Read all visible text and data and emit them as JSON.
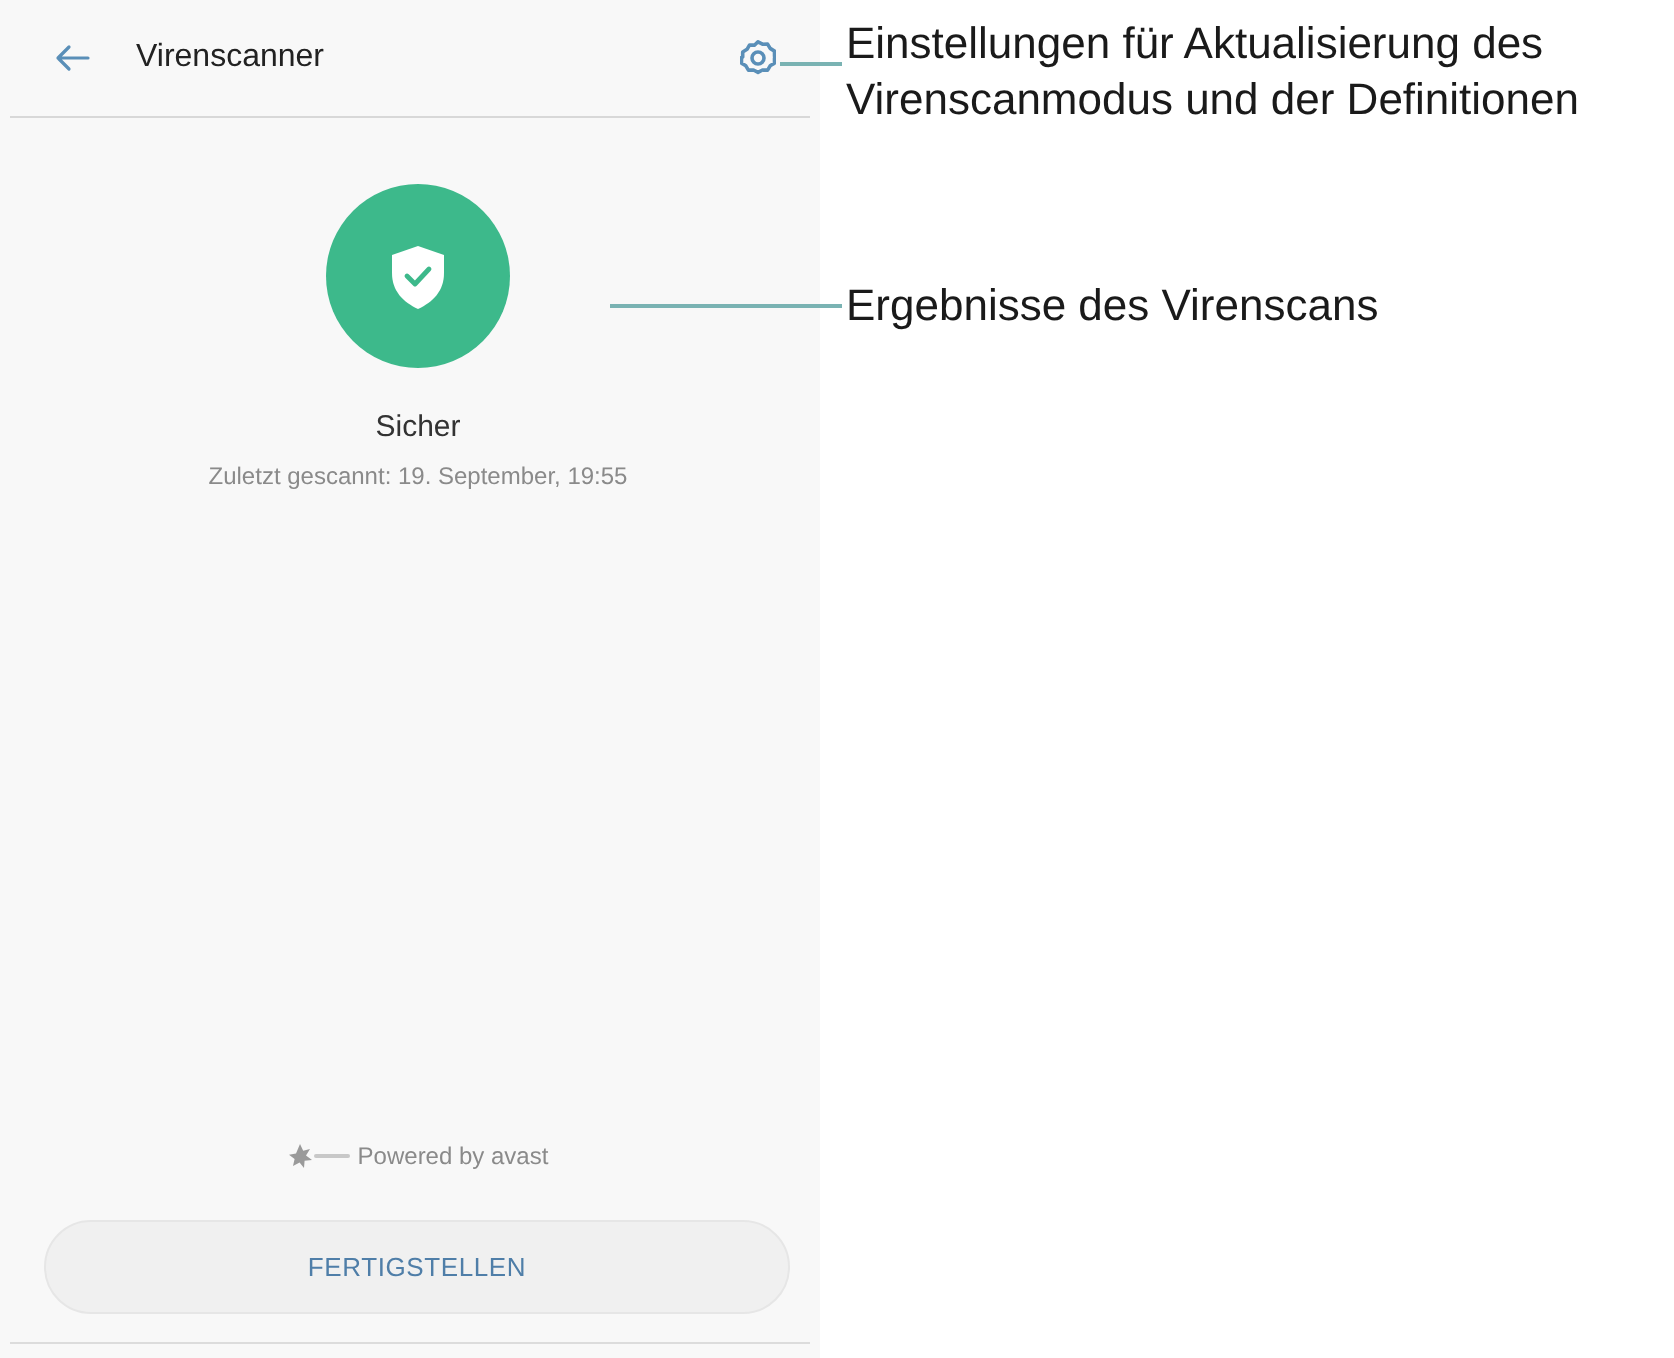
{
  "screen": {
    "header": {
      "title": "Virenscanner",
      "callout": {
        "lines": [
          "Einstellungen für Aktualisierung des",
          "Virenscanmodus und der Definitionen"
        ]
      }
    },
    "status": {
      "title": "Sicher",
      "last_scan": "Zuletzt gescannt: 19. September, 19:55",
      "callout": {
        "lines": [
          "Ergebnisse des Virenscans"
        ]
      }
    },
    "footer": {
      "powered_by": "Powered by avast",
      "finish_button": "FERTIGSTELLEN"
    }
  }
}
